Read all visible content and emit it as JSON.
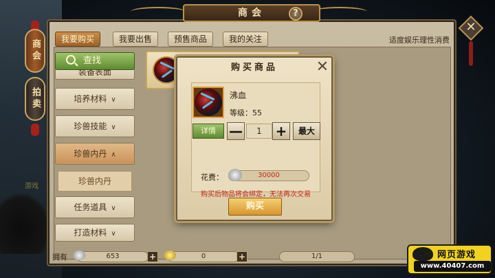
{
  "window": {
    "title": "商会"
  },
  "side_tabs": [
    {
      "label": "商会",
      "active": true
    },
    {
      "label": "拍卖",
      "active": false
    }
  ],
  "top_tabs": [
    {
      "label": "我要购买",
      "active": true
    },
    {
      "label": "我要出售",
      "active": false
    },
    {
      "label": "预售商品",
      "active": false
    },
    {
      "label": "我的关注",
      "active": false
    }
  ],
  "hint": "适度娱乐理性消费",
  "search": {
    "label": "查找"
  },
  "categories": [
    {
      "label": "装备表面",
      "active": false
    },
    {
      "label": "培养材料",
      "active": false
    },
    {
      "label": "珍兽技能",
      "active": false
    },
    {
      "label": "珍兽内丹",
      "active": true
    },
    {
      "label": "任务道具",
      "active": false
    },
    {
      "label": "打造材料",
      "active": false
    }
  ],
  "subcategory": {
    "label": "珍兽内丹"
  },
  "ghost_label": "游戏",
  "bottom": {
    "own_label": "拥有",
    "silver": "653",
    "gold": "0",
    "plus": "+",
    "page": "1/1"
  },
  "modal": {
    "title": "购买商品",
    "item_name": "沸血",
    "level_text": "等级：55",
    "detail_label": "详情",
    "minus": "—",
    "plus": "+",
    "quantity": "1",
    "max_label": "最大",
    "cost_label": "花费：",
    "cost_value": "30000",
    "warning": "购买后物品将会绑定，无法再次交易",
    "buy_label": "购买"
  },
  "watermark": {
    "top": "网页游戏",
    "bottom": "www.40407.com"
  },
  "colors": {
    "accent_gold": "#c9a763",
    "buy_button": "#d7962e",
    "warning_red": "#c0261a",
    "search_green": "#5f8b32"
  }
}
